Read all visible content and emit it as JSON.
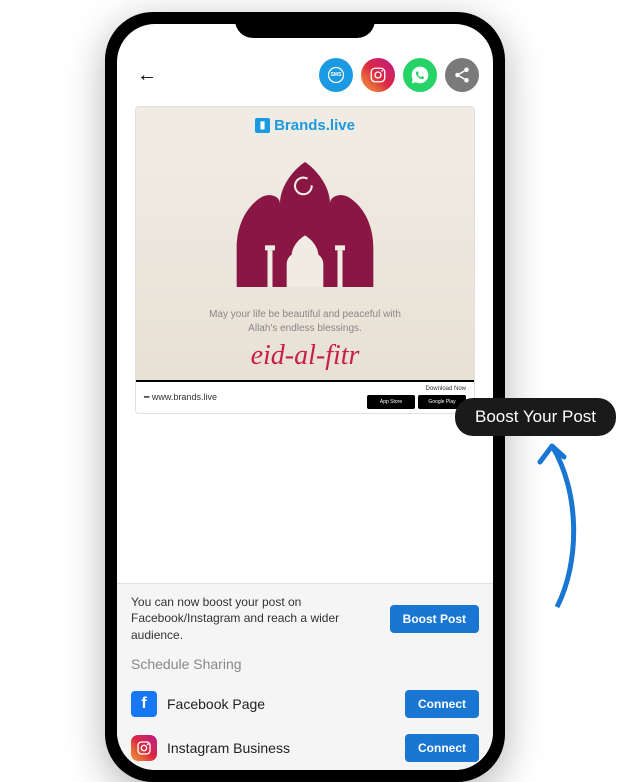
{
  "header": {
    "brand": "Brands.live"
  },
  "post": {
    "blessing_line1": "May your life be beautiful and peaceful with",
    "blessing_line2": "Allah's endless blessings.",
    "eid_title": "eid-al-fitr",
    "website": "www.brands.live",
    "download_label": "Download Now",
    "store_apple": "App Store",
    "store_google": "Google Play"
  },
  "boost": {
    "description": "You can now boost your post on Facebook/Instagram and reach a wider audience.",
    "button": "Boost Post"
  },
  "schedule": {
    "heading": "Schedule Sharing",
    "items": [
      {
        "label": "Facebook Page",
        "action": "Connect"
      },
      {
        "label": "Instagram Business",
        "action": "Connect"
      }
    ]
  },
  "tooltip": {
    "label": "Boost Your Post"
  },
  "icons": {
    "sms": "SMS"
  }
}
